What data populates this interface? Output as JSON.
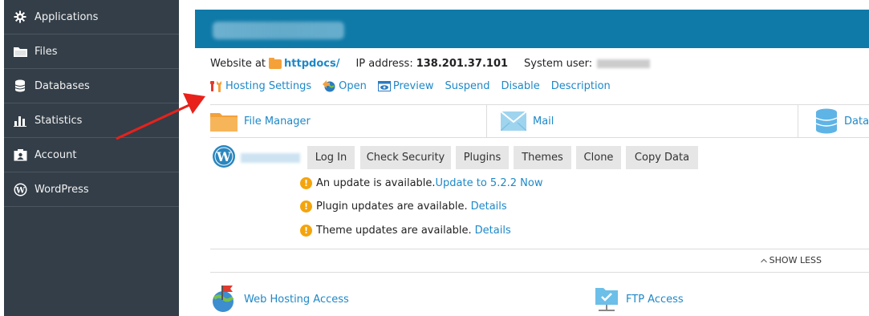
{
  "sidebar": {
    "items": [
      {
        "label": "Applications",
        "icon": "gear-icon"
      },
      {
        "label": "Files",
        "icon": "folder-icon"
      },
      {
        "label": "Databases",
        "icon": "database-icon"
      },
      {
        "label": "Statistics",
        "icon": "bar-chart-icon"
      },
      {
        "label": "Account",
        "icon": "account-icon"
      },
      {
        "label": "WordPress",
        "icon": "wordpress-icon"
      }
    ]
  },
  "info": {
    "website_prefix": "Website at",
    "httpdocs": "httpdocs/",
    "ip_label": "IP address:",
    "ip_value": "138.201.37.101",
    "system_user_label": "System user:"
  },
  "actions": {
    "hosting_settings": "Hosting Settings",
    "open": "Open",
    "preview": "Preview",
    "suspend": "Suspend",
    "disable": "Disable",
    "description": "Description"
  },
  "tools": {
    "file_manager": "File Manager",
    "mail": "Mail",
    "databases": "Database"
  },
  "wordpress": {
    "buttons": {
      "log_in": "Log In",
      "check_security": "Check Security",
      "plugins": "Plugins",
      "themes": "Themes",
      "clone": "Clone",
      "copy_data": "Copy Data"
    },
    "notices": {
      "update_text": "An update is available.",
      "update_link": "Update to 5.2.2 Now",
      "plugin_text": "Plugin updates are available.",
      "plugin_link": "Details",
      "theme_text": "Theme updates are available.",
      "theme_link": "Details"
    }
  },
  "show_less": "SHOW LESS",
  "access": {
    "web_hosting": "Web Hosting Access",
    "ftp": "FTP Access"
  },
  "colors": {
    "sidebar_bg": "#333e48",
    "header_bg": "#0f7aa8",
    "link": "#1e88c8",
    "warning": "#f4a40c",
    "arrow": "#e8211b"
  }
}
